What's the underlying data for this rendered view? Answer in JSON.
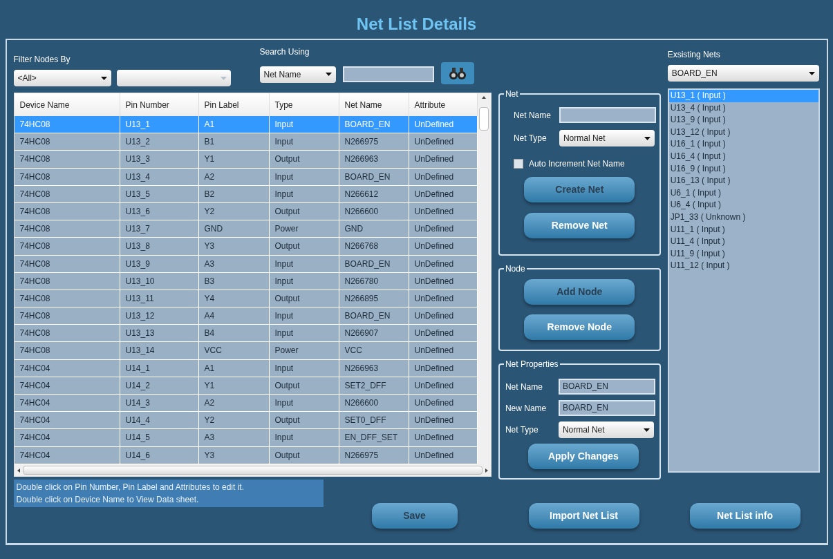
{
  "window": {
    "title": "Net List Details"
  },
  "filter": {
    "label": "Filter Nodes By",
    "value": "<All>"
  },
  "search": {
    "label": "Search Using",
    "by": "Net Name"
  },
  "table": {
    "columns": [
      "Device Name",
      "Pin Number",
      "Pin Label",
      "Type",
      "Net Name",
      "Attribute"
    ],
    "rows": [
      {
        "cells": [
          "74HC08",
          "U13_1",
          "A1",
          "Input",
          "BOARD_EN",
          "UnDefined"
        ],
        "selected": true
      },
      {
        "cells": [
          "74HC08",
          "U13_2",
          "B1",
          "Input",
          "N266975",
          "UnDefined"
        ],
        "selected": false
      },
      {
        "cells": [
          "74HC08",
          "U13_3",
          "Y1",
          "Output",
          "N266963",
          "UnDefined"
        ],
        "selected": false
      },
      {
        "cells": [
          "74HC08",
          "U13_4",
          "A2",
          "Input",
          "BOARD_EN",
          "UnDefined"
        ],
        "selected": false
      },
      {
        "cells": [
          "74HC08",
          "U13_5",
          "B2",
          "Input",
          "N266612",
          "UnDefined"
        ],
        "selected": false
      },
      {
        "cells": [
          "74HC08",
          "U13_6",
          "Y2",
          "Output",
          "N266600",
          "UnDefined"
        ],
        "selected": false
      },
      {
        "cells": [
          "74HC08",
          "U13_7",
          "GND",
          "Power",
          "GND",
          "UnDefined"
        ],
        "selected": false
      },
      {
        "cells": [
          "74HC08",
          "U13_8",
          "Y3",
          "Output",
          "N266768",
          "UnDefined"
        ],
        "selected": false
      },
      {
        "cells": [
          "74HC08",
          "U13_9",
          "A3",
          "Input",
          "BOARD_EN",
          "UnDefined"
        ],
        "selected": false
      },
      {
        "cells": [
          "74HC08",
          "U13_10",
          "B3",
          "Input",
          "N266780",
          "UnDefined"
        ],
        "selected": false
      },
      {
        "cells": [
          "74HC08",
          "U13_11",
          "Y4",
          "Output",
          "N266895",
          "UnDefined"
        ],
        "selected": false
      },
      {
        "cells": [
          "74HC08",
          "U13_12",
          "A4",
          "Input",
          "BOARD_EN",
          "UnDefined"
        ],
        "selected": false
      },
      {
        "cells": [
          "74HC08",
          "U13_13",
          "B4",
          "Input",
          "N266907",
          "UnDefined"
        ],
        "selected": false
      },
      {
        "cells": [
          "74HC08",
          "U13_14",
          "VCC",
          "Power",
          "VCC",
          "UnDefined"
        ],
        "selected": false
      },
      {
        "cells": [
          "74HC04",
          "U14_1",
          "A1",
          "Input",
          "N266963",
          "UnDefined"
        ],
        "selected": false
      },
      {
        "cells": [
          "74HC04",
          "U14_2",
          "Y1",
          "Output",
          "SET2_DFF",
          "UnDefined"
        ],
        "selected": false
      },
      {
        "cells": [
          "74HC04",
          "U14_3",
          "A2",
          "Input",
          "N266600",
          "UnDefined"
        ],
        "selected": false
      },
      {
        "cells": [
          "74HC04",
          "U14_4",
          "Y2",
          "Output",
          "SET0_DFF",
          "UnDefined"
        ],
        "selected": false
      },
      {
        "cells": [
          "74HC04",
          "U14_5",
          "A3",
          "Input",
          "EN_DFF_SET",
          "UnDefined"
        ],
        "selected": false
      },
      {
        "cells": [
          "74HC04",
          "U14_6",
          "Y3",
          "Output",
          "N266975",
          "UnDefined"
        ],
        "selected": false
      }
    ]
  },
  "hint": [
    "Double click on Pin Number, Pin Label and Attributes to edit it.",
    "Double click on Device Name to View Data sheet."
  ],
  "net": {
    "title": "Net",
    "name_label": "Net Name",
    "type_label": "Net Type",
    "type": "Normal Net",
    "auto_increment": {
      "label": "Auto Increment Net Name",
      "checked": false
    },
    "buttons": [
      {
        "label": "Create Net",
        "disabled": true
      },
      {
        "label": "Remove Net",
        "disabled": false
      }
    ]
  },
  "node": {
    "title": "Node",
    "buttons": [
      {
        "label": "Add Node",
        "disabled": true
      },
      {
        "label": "Remove Node",
        "disabled": false
      }
    ]
  },
  "net_properties": {
    "title": "Net Properties",
    "name_label": "Net Name",
    "name": "BOARD_EN",
    "new_name_label": "New Name",
    "new_name": "BOARD_EN",
    "type_label": "Net Type",
    "type": "Normal Net",
    "button": {
      "label": "Apply Changes",
      "disabled": false
    }
  },
  "existing_nets": {
    "label": "Exsisting Nets",
    "value": "BOARD_EN",
    "items": [
      {
        "label": "U13_1 ( Input )",
        "selected": true
      },
      {
        "label": "U13_4 ( Input )",
        "selected": false
      },
      {
        "label": "U13_9 ( Input )",
        "selected": false
      },
      {
        "label": "U13_12 ( Input )",
        "selected": false
      },
      {
        "label": "U16_1 ( Input )",
        "selected": false
      },
      {
        "label": "U16_4 ( Input )",
        "selected": false
      },
      {
        "label": "U16_9 ( Input )",
        "selected": false
      },
      {
        "label": "U16_13 ( Input )",
        "selected": false
      },
      {
        "label": "U6_1 ( Input )",
        "selected": false
      },
      {
        "label": "U6_4 ( Input )",
        "selected": false
      },
      {
        "label": "JP1_33 ( Unknown )",
        "selected": false
      },
      {
        "label": "U11_1 ( Input )",
        "selected": false
      },
      {
        "label": "U11_4 ( Input )",
        "selected": false
      },
      {
        "label": "U11_9 ( Input )",
        "selected": false
      },
      {
        "label": "U11_12 ( Input )",
        "selected": false
      }
    ]
  },
  "footer_buttons": [
    {
      "label": "Save",
      "disabled": true
    },
    {
      "label": "Import Net List",
      "disabled": false
    },
    {
      "label": "Net List info",
      "disabled": false
    }
  ]
}
